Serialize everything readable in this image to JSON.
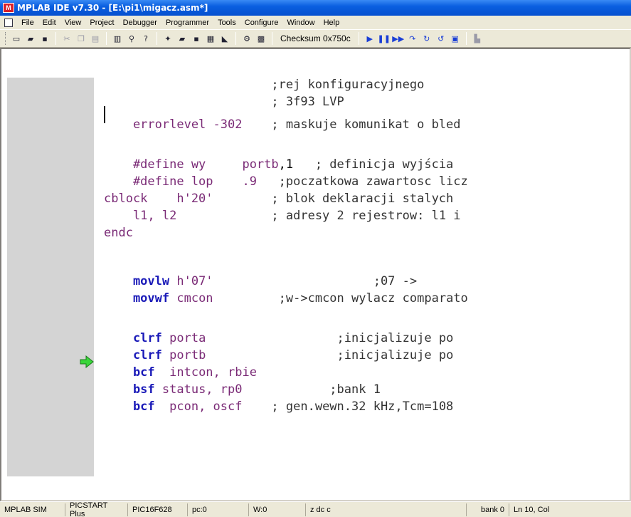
{
  "window": {
    "title": "MPLAB IDE v7.30 - [E:\\pi1\\migacz.asm*]"
  },
  "menu": [
    "File",
    "Edit",
    "View",
    "Project",
    "Debugger",
    "Programmer",
    "Tools",
    "Configure",
    "Window",
    "Help"
  ],
  "toolbar": {
    "checksum": "Checksum 0x750c"
  },
  "editor": {
    "lines": [
      {
        "segments": [
          {
            "t": "comment",
            "v": "                       ;rej konfiguracyjnego"
          }
        ]
      },
      {
        "segments": [
          {
            "t": "comment",
            "v": "                       ; 3f93 LVP"
          }
        ]
      },
      {
        "segments": [
          {
            "t": "kw-dir",
            "v": "    errorlevel -302"
          },
          {
            "t": "comment",
            "v": "    ; maskuje komunikat o bled"
          }
        ]
      },
      {
        "segments": [
          {
            "t": "plain",
            "v": ""
          }
        ]
      },
      {
        "segments": [
          {
            "t": "kw-dir",
            "v": "    #define wy     portb"
          },
          {
            "t": "plain",
            "v": ",1"
          },
          {
            "t": "comment",
            "v": "   ; definicja wyjścia"
          }
        ]
      },
      {
        "segments": [
          {
            "t": "kw-dir",
            "v": "    #define lop    .9"
          },
          {
            "t": "comment",
            "v": "   ;poczatkowa zawartosc licz"
          }
        ]
      },
      {
        "segments": [
          {
            "t": "kw-dir",
            "v": "cblock    h'20'"
          },
          {
            "t": "comment",
            "v": "        ; blok deklaracji stalych"
          }
        ]
      },
      {
        "segments": [
          {
            "t": "kw-dir",
            "v": "    l1, l2"
          },
          {
            "t": "comment",
            "v": "             ; adresy 2 rejestrow: l1 i"
          }
        ]
      },
      {
        "segments": [
          {
            "t": "kw-dir",
            "v": "endc"
          }
        ]
      },
      {
        "segments": [
          {
            "t": "plain",
            "v": ""
          }
        ]
      },
      {
        "segments": [
          {
            "t": "kw-ins",
            "v": "    movlw"
          },
          {
            "t": "operand",
            "v": " h'07'"
          },
          {
            "t": "comment",
            "v": "                      ;07 ->"
          }
        ]
      },
      {
        "segments": [
          {
            "t": "kw-ins",
            "v": "    movwf"
          },
          {
            "t": "operand",
            "v": " cmcon"
          },
          {
            "t": "comment",
            "v": "         ;w->cmcon wylacz comparato"
          }
        ]
      },
      {
        "segments": [
          {
            "t": "plain",
            "v": ""
          }
        ]
      },
      {
        "segments": [
          {
            "t": "kw-ins",
            "v": "    clrf"
          },
          {
            "t": "operand",
            "v": " porta"
          },
          {
            "t": "comment",
            "v": "                  ;inicjalizuje po"
          }
        ]
      },
      {
        "segments": [
          {
            "t": "kw-ins",
            "v": "    clrf"
          },
          {
            "t": "operand",
            "v": " portb"
          },
          {
            "t": "comment",
            "v": "                  ;inicjalizuje po"
          }
        ]
      },
      {
        "segments": [
          {
            "t": "kw-ins",
            "v": "    bcf"
          },
          {
            "t": "operand",
            "v": "  intcon, rbie"
          }
        ]
      },
      {
        "segments": [
          {
            "t": "kw-ins",
            "v": "    bsf"
          },
          {
            "t": "operand",
            "v": " status, rp0"
          },
          {
            "t": "comment",
            "v": "            ;bank 1"
          }
        ]
      },
      {
        "segments": [
          {
            "t": "kw-ins",
            "v": "    bcf"
          },
          {
            "t": "operand",
            "v": "  pcon, oscf"
          },
          {
            "t": "comment",
            "v": "    ; gen.wewn.32 kHz,Tcm=108"
          }
        ]
      }
    ]
  },
  "status": {
    "debugger": "MPLAB SIM",
    "programmer": "PICSTART Plus",
    "device": "PIC16F628",
    "pc": "pc:0",
    "w": "W:0",
    "flags": "z dc c",
    "bank": "bank 0",
    "position": "Ln 10, Col"
  }
}
